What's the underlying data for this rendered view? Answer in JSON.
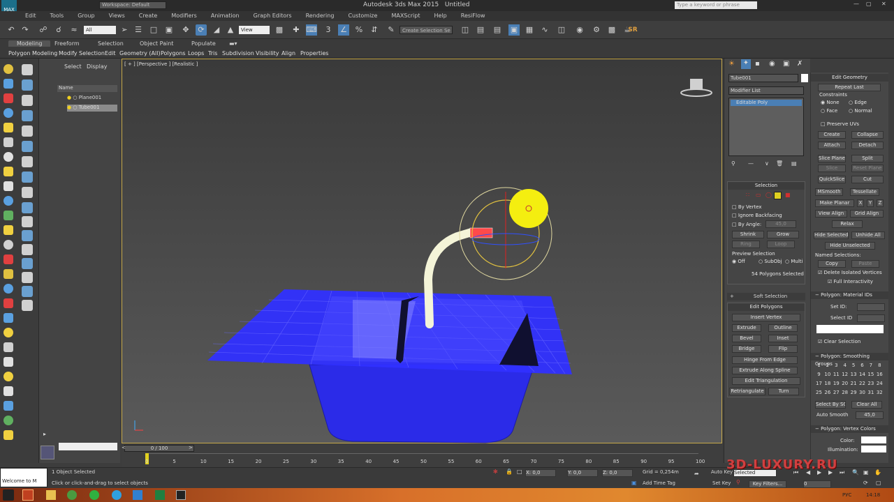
{
  "window": {
    "title": "Autodesk 3ds Max  2015",
    "doc": "Untitled",
    "workspace": "Workspace: Default",
    "search_placeholder": "Type a keyword or phrase"
  },
  "menu": [
    "Edit",
    "Tools",
    "Group",
    "Views",
    "Create",
    "Modifiers",
    "Animation",
    "Graph Editors",
    "Rendering",
    "Customize",
    "MAXScript",
    "Help",
    "ResiFlow"
  ],
  "toolbar": {
    "filter": "All",
    "view": "View",
    "selection_set": "Create Selection Se",
    "sr": "SR"
  },
  "ribbon": {
    "tabs": [
      "Modeling",
      "Freeform",
      "Selection",
      "Object Paint",
      "Populate"
    ],
    "subtabs": [
      "Polygon Modeling",
      "Modify Selection",
      "Edit",
      "Geometry (All)",
      "Polygons",
      "Loops",
      "Tris",
      "Subdivision",
      "Visibility",
      "Align",
      "Properties"
    ]
  },
  "scene": {
    "tabs": [
      "Select",
      "Display"
    ],
    "header": "Name",
    "items": [
      "Plane001",
      "Tube001"
    ]
  },
  "viewport": {
    "label": "[ + ] [Perspective ] [Realistic ]"
  },
  "modify": {
    "object_name": "Tube001",
    "modifier_list": "Modifier List",
    "stack_item": "Editable Poly",
    "selection_title": "Selection",
    "by_vertex": "By Vertex",
    "ignore_backfacing": "Ignore Backfacing",
    "by_angle": "By Angle:",
    "angle_val": "45,0",
    "shrink": "Shrink",
    "grow": "Grow",
    "ring": "Ring",
    "loop": "Loop",
    "preview": "Preview Selection",
    "off": "Off",
    "subobj": "SubObj",
    "multi": "Multi",
    "selected": "54 Polygons Selected",
    "soft_selection": "Soft Selection",
    "edit_polygons": "Edit Polygons",
    "insert_vertex": "Insert Vertex",
    "extrude": "Extrude",
    "outline": "Outline",
    "bevel": "Bevel",
    "inset": "Inset",
    "bridge": "Bridge",
    "flip": "Flip",
    "hinge": "Hinge From Edge",
    "extrude_spline": "Extrude Along Spline",
    "edit_tri": "Edit Triangulation",
    "retriangulate": "Retriangulate",
    "turn": "Turn"
  },
  "edit_geometry": {
    "title": "Edit Geometry",
    "repeat_last": "Repeat Last",
    "constraints": "Constraints",
    "none": "None",
    "edge": "Edge",
    "face": "Face",
    "normal": "Normal",
    "preserve_uvs": "Preserve UVs",
    "create": "Create",
    "collapse": "Collapse",
    "attach": "Attach",
    "detach": "Detach",
    "slice_plane": "Slice Plane",
    "split": "Split",
    "slice": "Slice",
    "reset_plane": "Reset Plane",
    "quickslice": "QuickSlice",
    "cut": "Cut",
    "msmooth": "MSmooth",
    "tessellate": "Tessellate",
    "make_planar": "Make Planar",
    "x": "X",
    "y": "Y",
    "z": "Z",
    "view_align": "View Align",
    "grid_align": "Grid Align",
    "relax": "Relax",
    "hide_selected": "Hide Selected",
    "unhide_all": "Unhide All",
    "hide_unselected": "Hide Unselected",
    "named_sel": "Named Selections:",
    "copy": "Copy",
    "paste": "Paste",
    "delete_isolated": "Delete Isolated Vertices",
    "full_interactivity": "Full Interactivity",
    "mat_title": "Polygon: Material IDs",
    "set_id": "Set ID:",
    "select_id": "Select ID",
    "clear_selection": "Clear Selection",
    "sg_title": "Polygon: Smoothing Groups",
    "select_by_sg": "Select By SG",
    "clear_all": "Clear All",
    "auto_smooth": "Auto Smooth",
    "auto_smooth_val": "45,0",
    "vc_title": "Polygon: Vertex Colors",
    "color": "Color:",
    "illumination": "Illumination:"
  },
  "timeline": {
    "frame": "0 / 100",
    "ticks": [
      "0",
      "5",
      "10",
      "15",
      "20",
      "25",
      "30",
      "35",
      "40",
      "45",
      "50",
      "55",
      "60",
      "65",
      "70",
      "75",
      "80",
      "85",
      "90",
      "95",
      "100"
    ]
  },
  "status": {
    "selected": "1 Object Selected",
    "hint": "Click or click-and-drag to select objects",
    "welcome": "Welcome to M",
    "x": "X: 0,0",
    "y": "Y: 0,0",
    "z": "Z: 0,0",
    "grid": "Grid = 0,254m",
    "add_time_tag": "Add Time Tag",
    "auto_key": "Auto Key",
    "selected_set": "Selected",
    "set_key": "Set Key",
    "key_filters": "Key Filters...",
    "frame_val": "0"
  },
  "watermark": "3D-LUXURY.RU",
  "taskbar": {
    "lang": "РУС",
    "time": "14:18"
  }
}
